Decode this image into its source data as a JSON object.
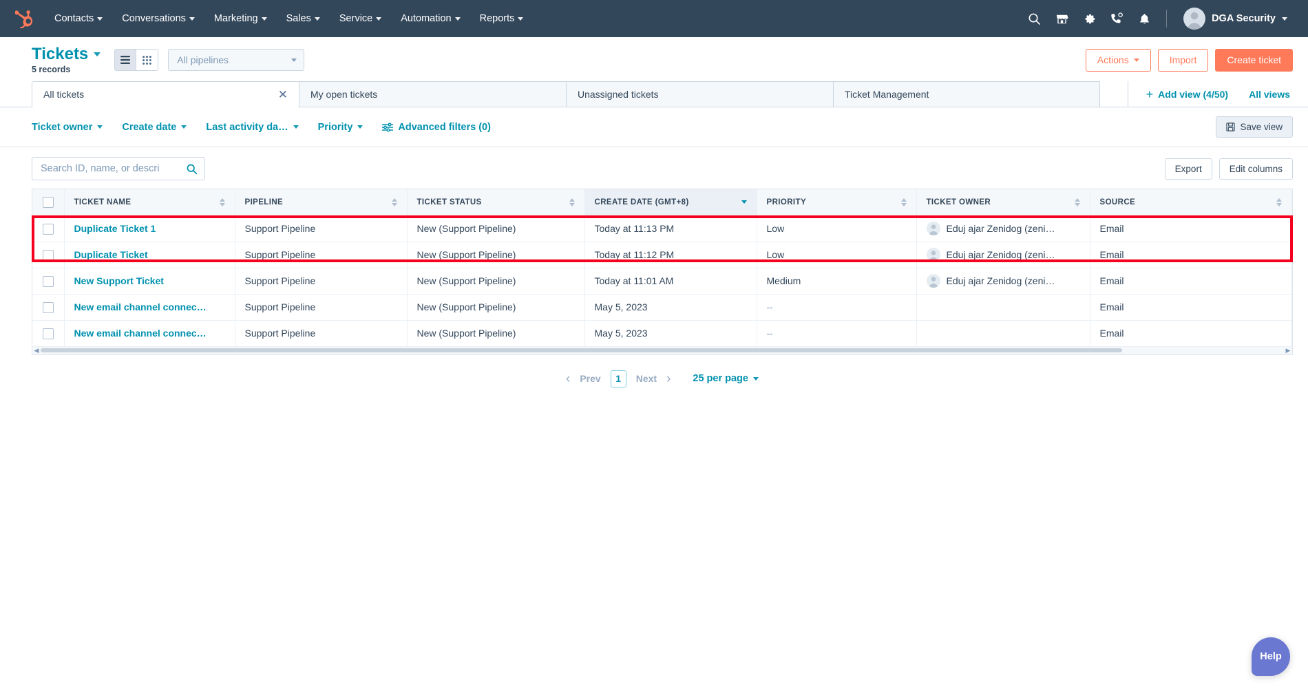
{
  "nav": {
    "logo": "hubspot-sprocket-logo",
    "items": [
      {
        "label": "Contacts",
        "has_dropdown": true
      },
      {
        "label": "Conversations",
        "has_dropdown": true
      },
      {
        "label": "Marketing",
        "has_dropdown": true
      },
      {
        "label": "Sales",
        "has_dropdown": true
      },
      {
        "label": "Service",
        "has_dropdown": true
      },
      {
        "label": "Automation",
        "has_dropdown": true
      },
      {
        "label": "Reports",
        "has_dropdown": true
      }
    ],
    "icons": [
      "search-icon",
      "marketplace-icon",
      "settings-gear-icon",
      "phone-call-icon",
      "notifications-bell-icon"
    ],
    "account_name": "DGA Security",
    "bg_color": "#33475b"
  },
  "header": {
    "title": "Tickets",
    "record_count": "5 records",
    "view_list_icon": "list-view-icon",
    "view_grid_icon": "grid-view-icon",
    "pipeline_filter": "All pipelines",
    "actions_label": "Actions",
    "import_label": "Import",
    "create_label": "Create ticket",
    "accent_color": "#ff7a59",
    "title_color": "#0091ae"
  },
  "tabs": {
    "items": [
      {
        "label": "All tickets",
        "active": true,
        "closable": true
      },
      {
        "label": "My open tickets",
        "active": false,
        "closable": false
      },
      {
        "label": "Unassigned tickets",
        "active": false,
        "closable": false
      },
      {
        "label": "Ticket Management",
        "active": false,
        "closable": false
      }
    ],
    "add_view_label": "Add view (4/50)",
    "all_views_label": "All views"
  },
  "filters": {
    "items": [
      "Ticket owner",
      "Create date",
      "Last activity da…",
      "Priority"
    ],
    "advanced_label": "Advanced filters (0)",
    "save_view_label": "Save view"
  },
  "toolbar": {
    "search_placeholder": "Search ID, name, or descri",
    "search_value": "",
    "export_label": "Export",
    "edit_columns_label": "Edit columns"
  },
  "table": {
    "columns": [
      {
        "label": "TICKET NAME",
        "sortable": true,
        "sorted": false
      },
      {
        "label": "PIPELINE",
        "sortable": true,
        "sorted": false
      },
      {
        "label": "TICKET STATUS",
        "sortable": true,
        "sorted": false
      },
      {
        "label": "CREATE DATE (GMT+8)",
        "sortable": true,
        "sorted": true,
        "direction": "desc"
      },
      {
        "label": "PRIORITY",
        "sortable": true,
        "sorted": false
      },
      {
        "label": "TICKET OWNER",
        "sortable": true,
        "sorted": false
      },
      {
        "label": "SOURCE",
        "sortable": true,
        "sorted": false
      }
    ],
    "rows": [
      {
        "name": "Duplicate Ticket 1",
        "pipeline": "Support Pipeline",
        "status": "New (Support Pipeline)",
        "create_date": "Today at 11:13 PM",
        "priority": "Low",
        "owner": "Eduj ajar Zenidog (zeni…",
        "has_owner": true,
        "source": "Email",
        "highlighted": true
      },
      {
        "name": "Duplicate Ticket",
        "pipeline": "Support Pipeline",
        "status": "New (Support Pipeline)",
        "create_date": "Today at 11:12 PM",
        "priority": "Low",
        "owner": "Eduj ajar Zenidog (zeni…",
        "has_owner": true,
        "source": "Email",
        "highlighted": true
      },
      {
        "name": "New Support Ticket",
        "pipeline": "Support Pipeline",
        "status": "New (Support Pipeline)",
        "create_date": "Today at 11:01 AM",
        "priority": "Medium",
        "owner": "Eduj ajar Zenidog (zeni…",
        "has_owner": true,
        "source": "Email",
        "highlighted": false
      },
      {
        "name": "New email channel connec…",
        "pipeline": "Support Pipeline",
        "status": "New (Support Pipeline)",
        "create_date": "May 5, 2023",
        "priority": "--",
        "owner": "",
        "has_owner": false,
        "source": "Email",
        "highlighted": false
      },
      {
        "name": "New email channel connec…",
        "pipeline": "Support Pipeline",
        "status": "New (Support Pipeline)",
        "create_date": "May 5, 2023",
        "priority": "--",
        "owner": "",
        "has_owner": false,
        "source": "Email",
        "highlighted": false
      }
    ],
    "annotation_color": "#f5001e"
  },
  "pagination": {
    "prev_label": "Prev",
    "current_page": "1",
    "next_label": "Next",
    "per_page_label": "25 per page"
  },
  "help": {
    "label": "Help",
    "color": "#6a78d1"
  }
}
